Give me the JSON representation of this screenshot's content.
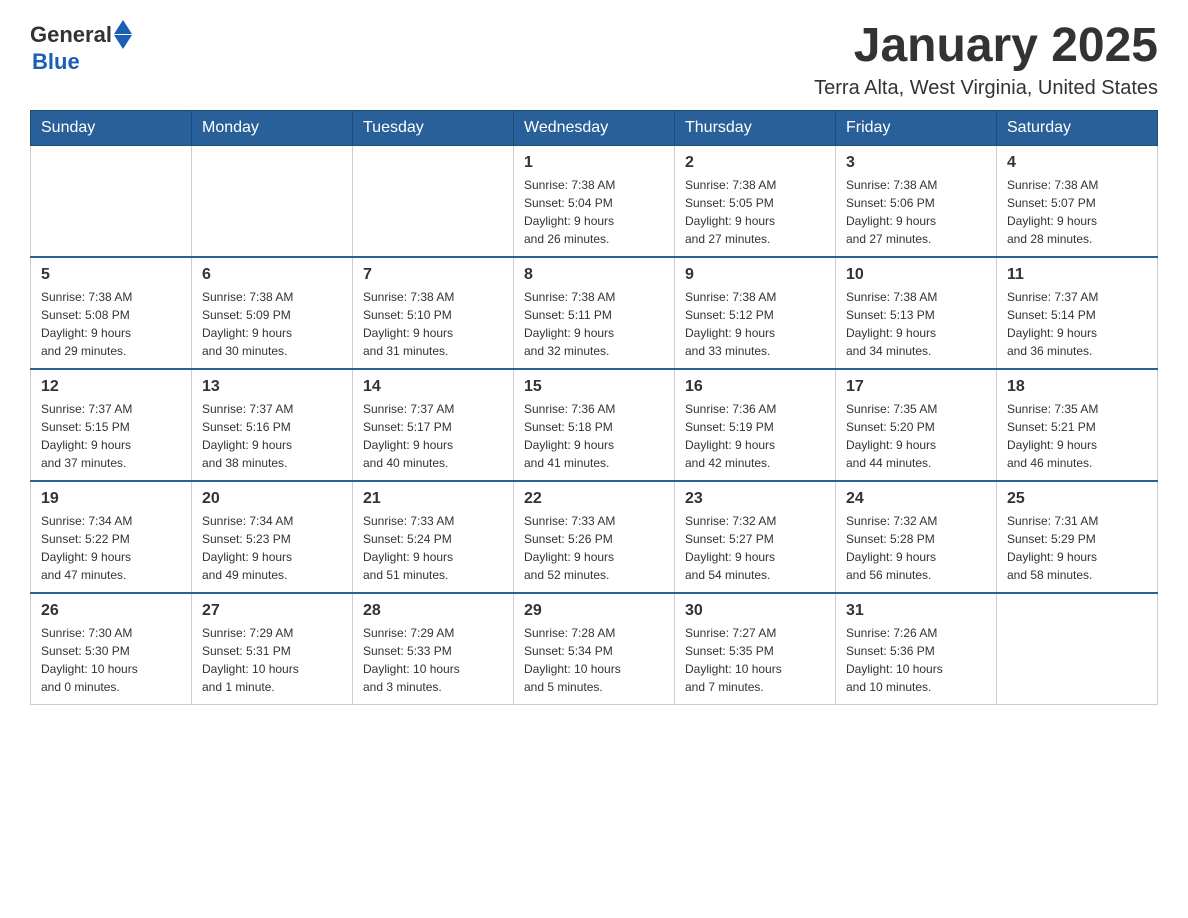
{
  "header": {
    "logo_general": "General",
    "logo_blue": "Blue",
    "title": "January 2025",
    "subtitle": "Terra Alta, West Virginia, United States"
  },
  "days_of_week": [
    "Sunday",
    "Monday",
    "Tuesday",
    "Wednesday",
    "Thursday",
    "Friday",
    "Saturday"
  ],
  "weeks": [
    [
      {
        "day": "",
        "info": ""
      },
      {
        "day": "",
        "info": ""
      },
      {
        "day": "",
        "info": ""
      },
      {
        "day": "1",
        "info": "Sunrise: 7:38 AM\nSunset: 5:04 PM\nDaylight: 9 hours\nand 26 minutes."
      },
      {
        "day": "2",
        "info": "Sunrise: 7:38 AM\nSunset: 5:05 PM\nDaylight: 9 hours\nand 27 minutes."
      },
      {
        "day": "3",
        "info": "Sunrise: 7:38 AM\nSunset: 5:06 PM\nDaylight: 9 hours\nand 27 minutes."
      },
      {
        "day": "4",
        "info": "Sunrise: 7:38 AM\nSunset: 5:07 PM\nDaylight: 9 hours\nand 28 minutes."
      }
    ],
    [
      {
        "day": "5",
        "info": "Sunrise: 7:38 AM\nSunset: 5:08 PM\nDaylight: 9 hours\nand 29 minutes."
      },
      {
        "day": "6",
        "info": "Sunrise: 7:38 AM\nSunset: 5:09 PM\nDaylight: 9 hours\nand 30 minutes."
      },
      {
        "day": "7",
        "info": "Sunrise: 7:38 AM\nSunset: 5:10 PM\nDaylight: 9 hours\nand 31 minutes."
      },
      {
        "day": "8",
        "info": "Sunrise: 7:38 AM\nSunset: 5:11 PM\nDaylight: 9 hours\nand 32 minutes."
      },
      {
        "day": "9",
        "info": "Sunrise: 7:38 AM\nSunset: 5:12 PM\nDaylight: 9 hours\nand 33 minutes."
      },
      {
        "day": "10",
        "info": "Sunrise: 7:38 AM\nSunset: 5:13 PM\nDaylight: 9 hours\nand 34 minutes."
      },
      {
        "day": "11",
        "info": "Sunrise: 7:37 AM\nSunset: 5:14 PM\nDaylight: 9 hours\nand 36 minutes."
      }
    ],
    [
      {
        "day": "12",
        "info": "Sunrise: 7:37 AM\nSunset: 5:15 PM\nDaylight: 9 hours\nand 37 minutes."
      },
      {
        "day": "13",
        "info": "Sunrise: 7:37 AM\nSunset: 5:16 PM\nDaylight: 9 hours\nand 38 minutes."
      },
      {
        "day": "14",
        "info": "Sunrise: 7:37 AM\nSunset: 5:17 PM\nDaylight: 9 hours\nand 40 minutes."
      },
      {
        "day": "15",
        "info": "Sunrise: 7:36 AM\nSunset: 5:18 PM\nDaylight: 9 hours\nand 41 minutes."
      },
      {
        "day": "16",
        "info": "Sunrise: 7:36 AM\nSunset: 5:19 PM\nDaylight: 9 hours\nand 42 minutes."
      },
      {
        "day": "17",
        "info": "Sunrise: 7:35 AM\nSunset: 5:20 PM\nDaylight: 9 hours\nand 44 minutes."
      },
      {
        "day": "18",
        "info": "Sunrise: 7:35 AM\nSunset: 5:21 PM\nDaylight: 9 hours\nand 46 minutes."
      }
    ],
    [
      {
        "day": "19",
        "info": "Sunrise: 7:34 AM\nSunset: 5:22 PM\nDaylight: 9 hours\nand 47 minutes."
      },
      {
        "day": "20",
        "info": "Sunrise: 7:34 AM\nSunset: 5:23 PM\nDaylight: 9 hours\nand 49 minutes."
      },
      {
        "day": "21",
        "info": "Sunrise: 7:33 AM\nSunset: 5:24 PM\nDaylight: 9 hours\nand 51 minutes."
      },
      {
        "day": "22",
        "info": "Sunrise: 7:33 AM\nSunset: 5:26 PM\nDaylight: 9 hours\nand 52 minutes."
      },
      {
        "day": "23",
        "info": "Sunrise: 7:32 AM\nSunset: 5:27 PM\nDaylight: 9 hours\nand 54 minutes."
      },
      {
        "day": "24",
        "info": "Sunrise: 7:32 AM\nSunset: 5:28 PM\nDaylight: 9 hours\nand 56 minutes."
      },
      {
        "day": "25",
        "info": "Sunrise: 7:31 AM\nSunset: 5:29 PM\nDaylight: 9 hours\nand 58 minutes."
      }
    ],
    [
      {
        "day": "26",
        "info": "Sunrise: 7:30 AM\nSunset: 5:30 PM\nDaylight: 10 hours\nand 0 minutes."
      },
      {
        "day": "27",
        "info": "Sunrise: 7:29 AM\nSunset: 5:31 PM\nDaylight: 10 hours\nand 1 minute."
      },
      {
        "day": "28",
        "info": "Sunrise: 7:29 AM\nSunset: 5:33 PM\nDaylight: 10 hours\nand 3 minutes."
      },
      {
        "day": "29",
        "info": "Sunrise: 7:28 AM\nSunset: 5:34 PM\nDaylight: 10 hours\nand 5 minutes."
      },
      {
        "day": "30",
        "info": "Sunrise: 7:27 AM\nSunset: 5:35 PM\nDaylight: 10 hours\nand 7 minutes."
      },
      {
        "day": "31",
        "info": "Sunrise: 7:26 AM\nSunset: 5:36 PM\nDaylight: 10 hours\nand 10 minutes."
      },
      {
        "day": "",
        "info": ""
      }
    ]
  ]
}
